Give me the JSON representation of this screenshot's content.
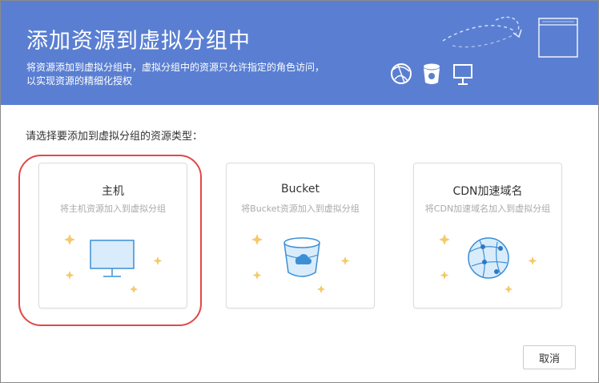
{
  "header": {
    "title": "添加资源到虚拟分组中",
    "description": "将资源添加到虚拟分组中，虚拟分组中的资源只允许指定的角色访问，以实现资源的精细化授权"
  },
  "prompt": "请选择要添加到虚拟分组的资源类型：",
  "cards": [
    {
      "title": "主机",
      "description": "将主机资源加入到虚拟分组",
      "icon": "monitor-icon"
    },
    {
      "title": "Bucket",
      "description": "将Bucket资源加入到虚拟分组",
      "icon": "bucket-icon"
    },
    {
      "title": "CDN加速域名",
      "description": "将CDN加速域名加入到虚拟分组",
      "icon": "globe-icon"
    }
  ],
  "buttons": {
    "cancel": "取消"
  },
  "colors": {
    "header_bg": "#5a7fd2",
    "highlight": "#e24848",
    "icon_blue": "#3a8fd6",
    "sparkle": "#f5c96a"
  }
}
